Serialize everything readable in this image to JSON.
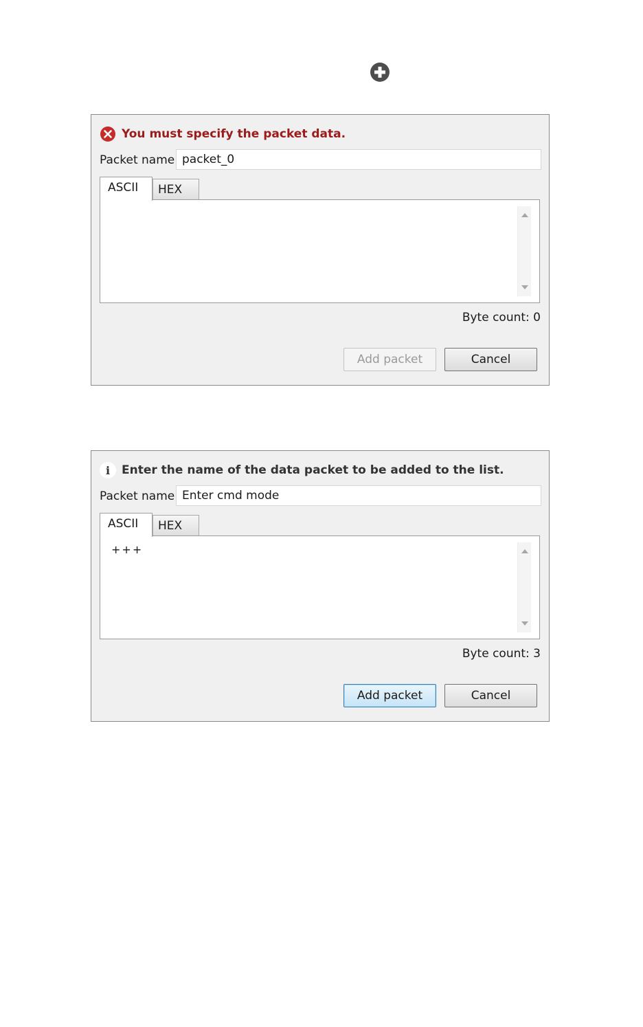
{
  "top_icon": "add-circle-icon",
  "colors": {
    "dialog_bg": "#f0f0f0",
    "error_text": "#9b1b1b",
    "error_icon": "#c42b2b",
    "primary_border": "#3c7fb1"
  },
  "dialogs": [
    {
      "message_icon": "error-icon",
      "message": "You must specify the packet data.",
      "packet_name_label": "Packet name",
      "packet_name_value": "packet_0",
      "tabs": [
        "ASCII",
        "HEX"
      ],
      "active_tab": "ASCII",
      "data_text": "",
      "byte_count": "Byte count: 0",
      "add_button": "Add packet",
      "add_button_enabled": false,
      "cancel_button": "Cancel"
    },
    {
      "message_icon": "info-icon",
      "message": "Enter the name of the data packet to be added to the list.",
      "packet_name_label": "Packet name",
      "packet_name_value": "Enter cmd mode",
      "tabs": [
        "ASCII",
        "HEX"
      ],
      "active_tab": "ASCII",
      "data_text": "+++",
      "byte_count": "Byte count: 3",
      "add_button": "Add packet",
      "add_button_enabled": true,
      "cancel_button": "Cancel"
    }
  ]
}
